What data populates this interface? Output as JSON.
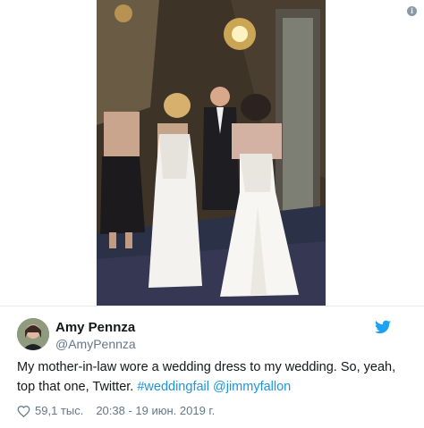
{
  "tweet": {
    "author_name": "Amy Pennza",
    "author_handle": "@AmyPennza",
    "text_plain": "My mother-in-law wore a wedding dress to my wedding. So, yeah, top that one, Twitter. ",
    "hashtag": "#weddingfail",
    "mention": "@jimmyfallon",
    "likes": "59,1 тыс.",
    "timestamp": "20:38 - 19 июн. 2019 г."
  },
  "icons": {
    "info": "info-icon",
    "twitter": "twitter-bird-icon",
    "like": "heart-icon"
  },
  "colors": {
    "link": "#1b95e0",
    "secondary_text": "#657786",
    "twitter_blue": "#1da1f2"
  }
}
